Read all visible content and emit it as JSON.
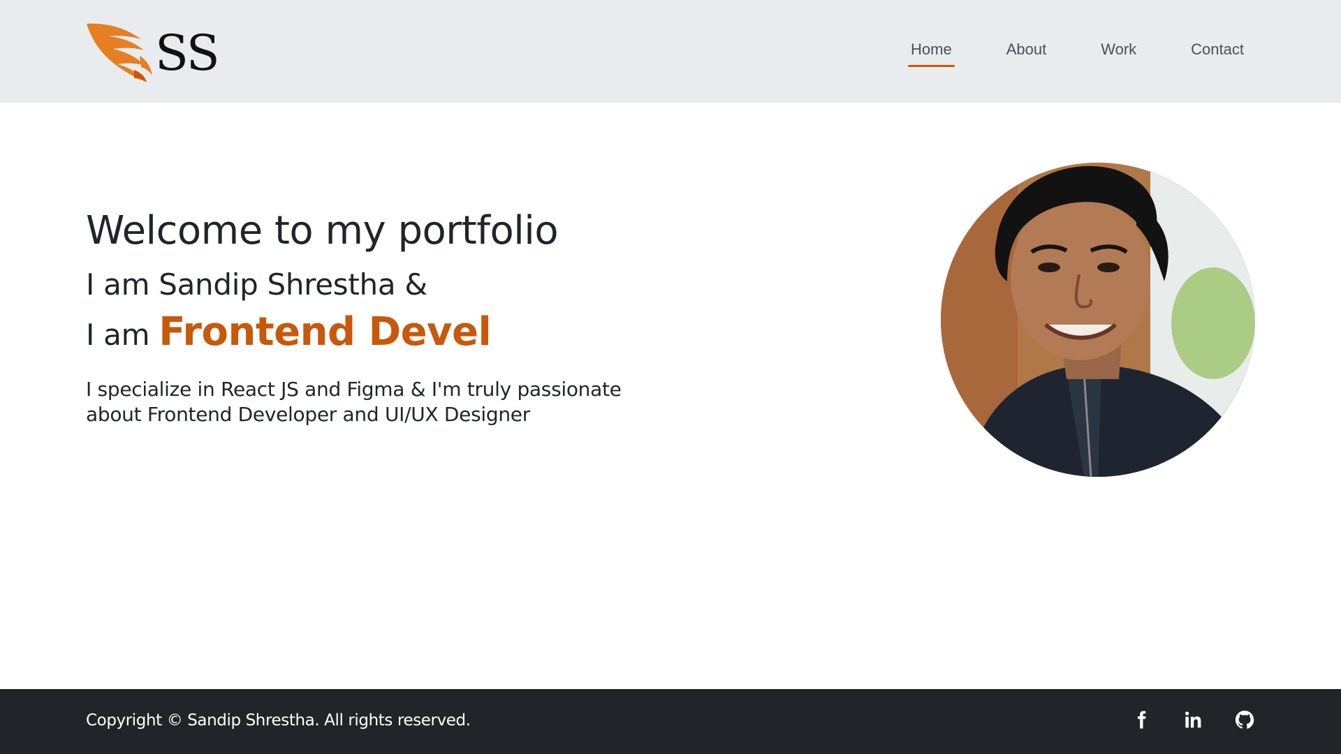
{
  "brand": {
    "logo_text": "SS",
    "accent_color": "#e67e22"
  },
  "nav": {
    "items": [
      {
        "label": "Home",
        "active": true
      },
      {
        "label": "About",
        "active": false
      },
      {
        "label": "Work",
        "active": false
      },
      {
        "label": "Contact",
        "active": false
      }
    ]
  },
  "hero": {
    "welcome": "Welcome to my portfolio",
    "intro_name": "I am Sandip Shrestha &",
    "intro_role_prefix": "I am ",
    "typed_text": "Frontend Devel",
    "typed_color": "#c8580a",
    "tagline": "I specialize in React JS and Figma & I'm truly passionate about Frontend Developer and UI/UX Designer"
  },
  "portrait": {
    "icon": "profile-photo"
  },
  "footer": {
    "copyright": "Copyright © Sandip Shrestha. All rights reserved.",
    "socials": [
      {
        "icon": "facebook-icon"
      },
      {
        "icon": "linkedin-icon"
      },
      {
        "icon": "github-icon"
      }
    ]
  }
}
